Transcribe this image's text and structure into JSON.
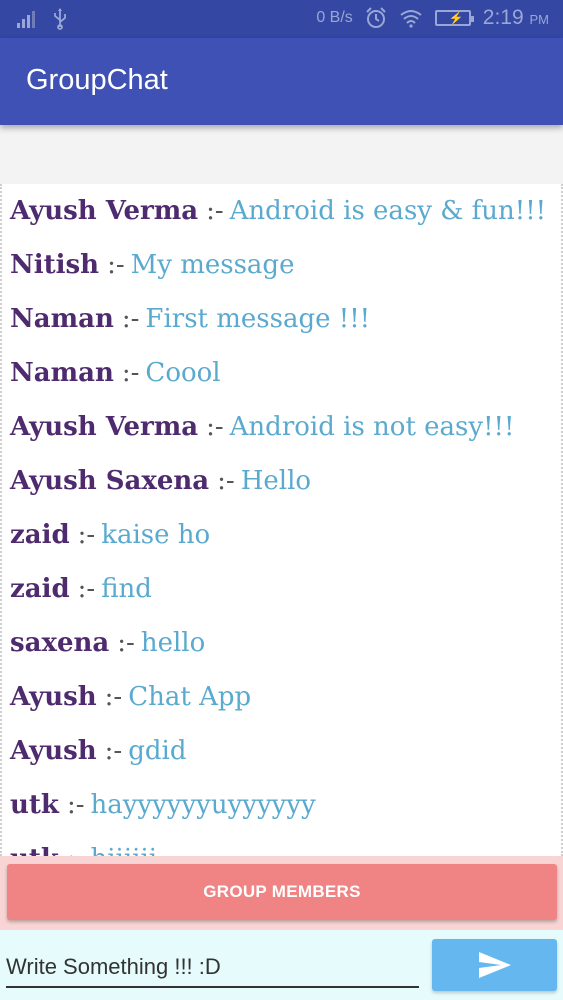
{
  "status_bar": {
    "net_speed": "0 B/s",
    "time": "2:19",
    "ampm": "PM"
  },
  "app_bar": {
    "title": "GroupChat"
  },
  "chat": {
    "separator": ":-",
    "messages": [
      {
        "name": "Ayush Verma",
        "text": "Android is easy & fun!!!"
      },
      {
        "name": "Nitish",
        "text": "My message"
      },
      {
        "name": "Naman",
        "text": "First message !!!"
      },
      {
        "name": "Naman",
        "text": "Coool"
      },
      {
        "name": "Ayush Verma",
        "text": "Android is not easy!!!"
      },
      {
        "name": "Ayush Saxena",
        "text": "Hello"
      },
      {
        "name": "zaid",
        "text": "kaise ho"
      },
      {
        "name": "zaid",
        "text": "find"
      },
      {
        "name": "saxena",
        "text": "hello"
      },
      {
        "name": "Ayush",
        "text": "Chat App"
      },
      {
        "name": "Ayush",
        "text": "gdid"
      },
      {
        "name": "utk",
        "text": "hayyyyyyuyyyyyy"
      },
      {
        "name": "utk",
        "text": "hiiiiii"
      }
    ]
  },
  "members_button": {
    "label": "GROUP MEMBERS"
  },
  "composer": {
    "placeholder": "Write Something !!! :D",
    "send_icon": "send-icon"
  },
  "colors": {
    "status_bar": "#3347a3",
    "app_bar": "#3f51b5",
    "name": "#4e2a6e",
    "message": "#5aa9cf",
    "members_button": "#f08484",
    "send_button": "#64b8ef"
  }
}
